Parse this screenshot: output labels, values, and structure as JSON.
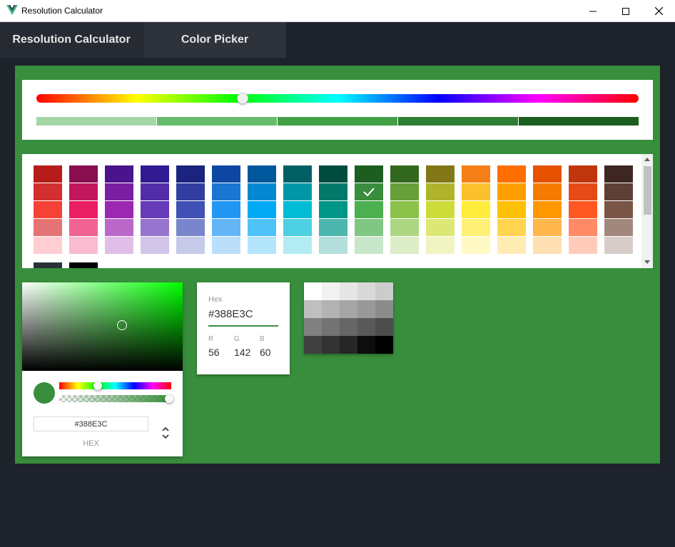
{
  "window": {
    "title": "Resolution Calculator",
    "icon": "vue-logo-icon",
    "controls": [
      "minimize-icon",
      "maximize-icon",
      "close-icon"
    ]
  },
  "tabs": [
    {
      "label": "Resolution Calculator",
      "active": false
    },
    {
      "label": "Color Picker",
      "active": true
    }
  ],
  "colors": {
    "accent": "#388E3C",
    "panel_bg": "#388e3c",
    "app_bg": "#1e222b"
  },
  "hue_slider": {
    "value_fraction": 0.35,
    "shades": [
      "#a5d6a7",
      "#66bb6a",
      "#43a047",
      "#2e7d32",
      "#1b5e20"
    ]
  },
  "swatches": {
    "columns": [
      [
        "#b71c1c",
        "#d32f2f",
        "#f44336",
        "#e57373",
        "#ffcdd2"
      ],
      [
        "#880e4f",
        "#c2185b",
        "#e91e63",
        "#f06292",
        "#f8bbd0"
      ],
      [
        "#4a148c",
        "#7b1fa2",
        "#9c27b0",
        "#ba68c8",
        "#e1bee7"
      ],
      [
        "#311b92",
        "#512da8",
        "#673ab7",
        "#9575cd",
        "#d1c4e9"
      ],
      [
        "#1a237e",
        "#303f9f",
        "#3f51b5",
        "#7986cb",
        "#c5cae9"
      ],
      [
        "#0d47a1",
        "#1976d2",
        "#2196f3",
        "#64b5f6",
        "#bbdefb"
      ],
      [
        "#01579b",
        "#0288d1",
        "#03a9f4",
        "#4fc3f7",
        "#b3e5fc"
      ],
      [
        "#006064",
        "#0097a7",
        "#00bcd4",
        "#4dd0e1",
        "#b2ebf2"
      ],
      [
        "#004d40",
        "#00796b",
        "#009688",
        "#4db6ac",
        "#b2dfdb"
      ],
      [
        "#1b5e20",
        "#388e3c",
        "#4caf50",
        "#81c784",
        "#c8e6c9"
      ],
      [
        "#33691e",
        "#689f38",
        "#8bc34a",
        "#aed581",
        "#dcedc8"
      ],
      [
        "#827717",
        "#afb42b",
        "#cddc39",
        "#dce775",
        "#f0f4c3"
      ],
      [
        "#f57f17",
        "#fbc02d",
        "#ffeb3b",
        "#fff176",
        "#fff9c4"
      ],
      [
        "#ff6f00",
        "#ffa000",
        "#ffc107",
        "#ffd54f",
        "#ffecb3"
      ],
      [
        "#e65100",
        "#f57c00",
        "#ff9800",
        "#ffb74d",
        "#ffe0b2"
      ],
      [
        "#bf360c",
        "#e64a19",
        "#ff5722",
        "#ff8a65",
        "#ffccbc"
      ],
      [
        "#3e2723",
        "#5d4037",
        "#795548",
        "#a1887f",
        "#d7ccc8"
      ]
    ],
    "selected_column": 9,
    "selected_row": 1,
    "extra_row": [
      "#263238",
      "#000000"
    ]
  },
  "picker": {
    "hex_input": "#388E3C",
    "mode_label": "HEX",
    "preview_color": "#388e3c"
  },
  "hex_display": {
    "label": "Hex",
    "value": "#388E3C",
    "r_label": "R",
    "g_label": "G",
    "b_label": "B",
    "r": "56",
    "g": "142",
    "b": "60"
  },
  "grays": [
    "#ffffff",
    "#f2f2f2",
    "#e6e6e6",
    "#d9d9d9",
    "#cccccc",
    "#bfbfbf",
    "#b3b3b3",
    "#a6a6a6",
    "#999999",
    "#8c8c8c",
    "#808080",
    "#737373",
    "#666666",
    "#595959",
    "#4d4d4d",
    "#404040",
    "#333333",
    "#262626",
    "#0d0d0d",
    "#000000"
  ]
}
